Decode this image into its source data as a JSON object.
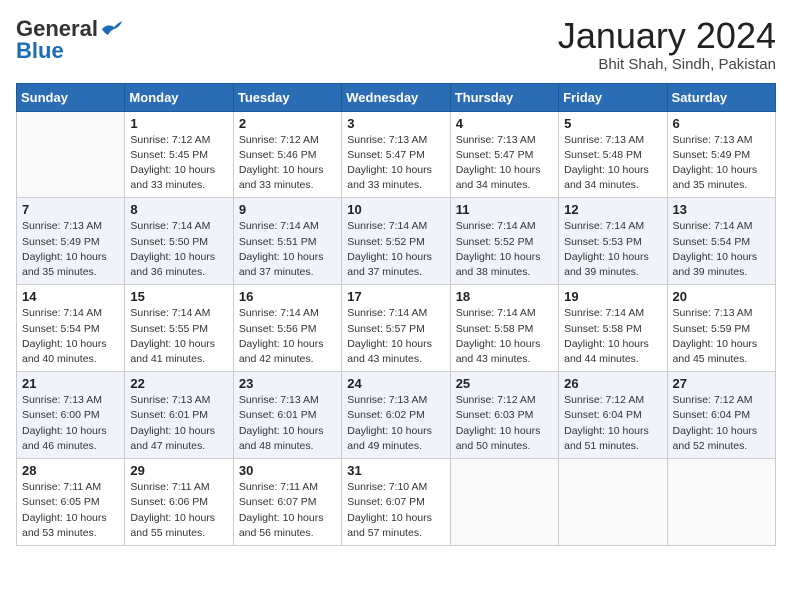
{
  "header": {
    "logo_general": "General",
    "logo_blue": "Blue",
    "month_title": "January 2024",
    "subtitle": "Bhit Shah, Sindh, Pakistan"
  },
  "days_of_week": [
    "Sunday",
    "Monday",
    "Tuesday",
    "Wednesday",
    "Thursday",
    "Friday",
    "Saturday"
  ],
  "weeks": [
    [
      {
        "day": "",
        "info": ""
      },
      {
        "day": "1",
        "info": "Sunrise: 7:12 AM\nSunset: 5:45 PM\nDaylight: 10 hours\nand 33 minutes."
      },
      {
        "day": "2",
        "info": "Sunrise: 7:12 AM\nSunset: 5:46 PM\nDaylight: 10 hours\nand 33 minutes."
      },
      {
        "day": "3",
        "info": "Sunrise: 7:13 AM\nSunset: 5:47 PM\nDaylight: 10 hours\nand 33 minutes."
      },
      {
        "day": "4",
        "info": "Sunrise: 7:13 AM\nSunset: 5:47 PM\nDaylight: 10 hours\nand 34 minutes."
      },
      {
        "day": "5",
        "info": "Sunrise: 7:13 AM\nSunset: 5:48 PM\nDaylight: 10 hours\nand 34 minutes."
      },
      {
        "day": "6",
        "info": "Sunrise: 7:13 AM\nSunset: 5:49 PM\nDaylight: 10 hours\nand 35 minutes."
      }
    ],
    [
      {
        "day": "7",
        "info": "Sunrise: 7:13 AM\nSunset: 5:49 PM\nDaylight: 10 hours\nand 35 minutes."
      },
      {
        "day": "8",
        "info": "Sunrise: 7:14 AM\nSunset: 5:50 PM\nDaylight: 10 hours\nand 36 minutes."
      },
      {
        "day": "9",
        "info": "Sunrise: 7:14 AM\nSunset: 5:51 PM\nDaylight: 10 hours\nand 37 minutes."
      },
      {
        "day": "10",
        "info": "Sunrise: 7:14 AM\nSunset: 5:52 PM\nDaylight: 10 hours\nand 37 minutes."
      },
      {
        "day": "11",
        "info": "Sunrise: 7:14 AM\nSunset: 5:52 PM\nDaylight: 10 hours\nand 38 minutes."
      },
      {
        "day": "12",
        "info": "Sunrise: 7:14 AM\nSunset: 5:53 PM\nDaylight: 10 hours\nand 39 minutes."
      },
      {
        "day": "13",
        "info": "Sunrise: 7:14 AM\nSunset: 5:54 PM\nDaylight: 10 hours\nand 39 minutes."
      }
    ],
    [
      {
        "day": "14",
        "info": "Sunrise: 7:14 AM\nSunset: 5:54 PM\nDaylight: 10 hours\nand 40 minutes."
      },
      {
        "day": "15",
        "info": "Sunrise: 7:14 AM\nSunset: 5:55 PM\nDaylight: 10 hours\nand 41 minutes."
      },
      {
        "day": "16",
        "info": "Sunrise: 7:14 AM\nSunset: 5:56 PM\nDaylight: 10 hours\nand 42 minutes."
      },
      {
        "day": "17",
        "info": "Sunrise: 7:14 AM\nSunset: 5:57 PM\nDaylight: 10 hours\nand 43 minutes."
      },
      {
        "day": "18",
        "info": "Sunrise: 7:14 AM\nSunset: 5:58 PM\nDaylight: 10 hours\nand 43 minutes."
      },
      {
        "day": "19",
        "info": "Sunrise: 7:14 AM\nSunset: 5:58 PM\nDaylight: 10 hours\nand 44 minutes."
      },
      {
        "day": "20",
        "info": "Sunrise: 7:13 AM\nSunset: 5:59 PM\nDaylight: 10 hours\nand 45 minutes."
      }
    ],
    [
      {
        "day": "21",
        "info": "Sunrise: 7:13 AM\nSunset: 6:00 PM\nDaylight: 10 hours\nand 46 minutes."
      },
      {
        "day": "22",
        "info": "Sunrise: 7:13 AM\nSunset: 6:01 PM\nDaylight: 10 hours\nand 47 minutes."
      },
      {
        "day": "23",
        "info": "Sunrise: 7:13 AM\nSunset: 6:01 PM\nDaylight: 10 hours\nand 48 minutes."
      },
      {
        "day": "24",
        "info": "Sunrise: 7:13 AM\nSunset: 6:02 PM\nDaylight: 10 hours\nand 49 minutes."
      },
      {
        "day": "25",
        "info": "Sunrise: 7:12 AM\nSunset: 6:03 PM\nDaylight: 10 hours\nand 50 minutes."
      },
      {
        "day": "26",
        "info": "Sunrise: 7:12 AM\nSunset: 6:04 PM\nDaylight: 10 hours\nand 51 minutes."
      },
      {
        "day": "27",
        "info": "Sunrise: 7:12 AM\nSunset: 6:04 PM\nDaylight: 10 hours\nand 52 minutes."
      }
    ],
    [
      {
        "day": "28",
        "info": "Sunrise: 7:11 AM\nSunset: 6:05 PM\nDaylight: 10 hours\nand 53 minutes."
      },
      {
        "day": "29",
        "info": "Sunrise: 7:11 AM\nSunset: 6:06 PM\nDaylight: 10 hours\nand 55 minutes."
      },
      {
        "day": "30",
        "info": "Sunrise: 7:11 AM\nSunset: 6:07 PM\nDaylight: 10 hours\nand 56 minutes."
      },
      {
        "day": "31",
        "info": "Sunrise: 7:10 AM\nSunset: 6:07 PM\nDaylight: 10 hours\nand 57 minutes."
      },
      {
        "day": "",
        "info": ""
      },
      {
        "day": "",
        "info": ""
      },
      {
        "day": "",
        "info": ""
      }
    ]
  ]
}
